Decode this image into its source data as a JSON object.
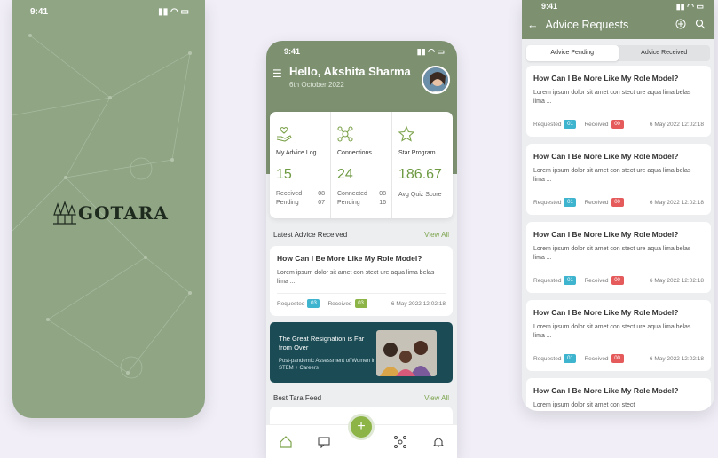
{
  "splash": {
    "time": "9:41",
    "brand": "GOTARA"
  },
  "home": {
    "time": "9:41",
    "greeting": "Hello, Akshita Sharma",
    "date": "6th October 2022",
    "stats": [
      {
        "title": "My Advice Log",
        "value": "15",
        "row1_label": "Received",
        "row1_value": "08",
        "row2_label": "Pending",
        "row2_value": "07"
      },
      {
        "title": "Connections",
        "value": "24",
        "row1_label": "Connected",
        "row1_value": "08",
        "row2_label": "Pending",
        "row2_value": "16"
      },
      {
        "title": "Star Program",
        "value": "186.67",
        "note": "Avg Quiz Score"
      }
    ],
    "latest": {
      "section_title": "Latest Advice Received",
      "view_all": "View All",
      "question": "How Can I Be More Like My Role Model?",
      "body": "Lorem ipsum dolor sit amet con stect ure aqua lima belas lima ...",
      "requested_label": "Requested",
      "requested_count": "03",
      "received_label": "Received",
      "received_count": "03",
      "timestamp": "6 May 2022 12:02:18"
    },
    "banner": {
      "title": "The Great Resignation is Far from Over",
      "subtitle": "Post-pandemic Assessment of Women in STEM + Careers"
    },
    "feed": {
      "section_title": "Best Tara Feed",
      "view_all": "View All"
    },
    "fab_label": "+",
    "nav": [
      "home-icon",
      "chat-icon",
      "connections-icon",
      "bell-icon"
    ]
  },
  "advice": {
    "time": "9:41",
    "title": "Advice Requests",
    "tabs": [
      "Advice Pending",
      "Advice Received"
    ],
    "active_tab": "Advice Pending",
    "cards": [
      {
        "question": "How Can I Be More Like My Role Model?",
        "body": "Lorem ipsum dolor sit amet con stect ure aqua lima belas lima ...",
        "requested_label": "Requested",
        "requested": "01",
        "received_label": "Received",
        "received": "00",
        "timestamp": "6 May 2022 12:02:18"
      },
      {
        "question": "How Can I Be More Like My Role Model?",
        "body": "Lorem ipsum dolor sit amet con stect ure aqua lima belas lima ...",
        "requested_label": "Requested",
        "requested": "01",
        "received_label": "Received",
        "received": "00",
        "timestamp": "6 May 2022 12:02:18"
      },
      {
        "question": "How Can I Be More Like My Role Model?",
        "body": "Lorem ipsum dolor sit amet con stect ure aqua lima belas lima ...",
        "requested_label": "Requested",
        "requested": "01",
        "received_label": "Received",
        "received": "00",
        "timestamp": "6 May 2022 12:02:18"
      },
      {
        "question": "How Can I Be More Like My Role Model?",
        "body": "Lorem ipsum dolor sit amet con stect ure aqua lima belas lima ...",
        "requested_label": "Requested",
        "requested": "01",
        "received_label": "Received",
        "received": "00",
        "timestamp": "6 May 2022 12:02:18"
      },
      {
        "question": "How Can I Be More Like My Role Model?",
        "body": "Lorem ipsum dolor sit amet con stect"
      }
    ]
  },
  "colors": {
    "brand_green": "#7d9171",
    "accent_green": "#8cb446",
    "badge_blue": "#3fb4cf",
    "badge_red": "#e55a5a",
    "banner_teal": "#1b4b55"
  }
}
